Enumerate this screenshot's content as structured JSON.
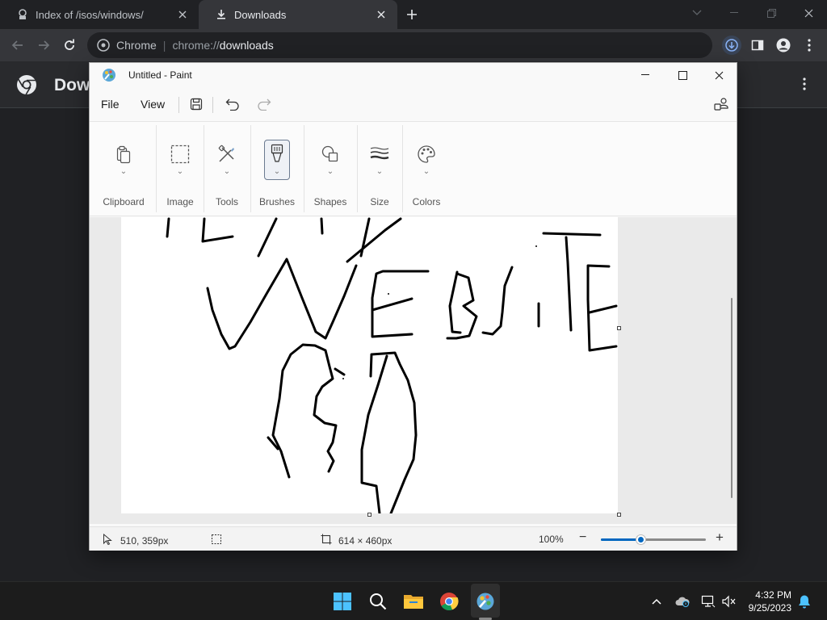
{
  "chrome": {
    "tabs": [
      {
        "label": "Index of /isos/windows/",
        "active": false
      },
      {
        "label": "Downloads",
        "active": true
      }
    ],
    "omnibox": {
      "chip": "Chrome",
      "scheme": "chrome://",
      "host": "downloads"
    },
    "page": {
      "title": "Downloads"
    }
  },
  "paint": {
    "window_title": "Untitled - Paint",
    "menu": {
      "file": "File",
      "view": "View"
    },
    "ribbon": [
      {
        "label": "Clipboard",
        "icon": "clipboard-icon"
      },
      {
        "label": "Image",
        "icon": "selection-icon"
      },
      {
        "label": "Tools",
        "icon": "tools-icon"
      },
      {
        "label": "Brushes",
        "icon": "brush-icon"
      },
      {
        "label": "Shapes",
        "icon": "shapes-icon"
      },
      {
        "label": "Size",
        "icon": "size-icon"
      },
      {
        "label": "Colors",
        "icon": "palette-icon"
      }
    ],
    "status": {
      "cursor_pos": "510, 359px",
      "canvas_size": "614 × 460px",
      "zoom": "100%",
      "zoom_fraction": 0.37
    },
    "canvas_text_hint": "WEBSITE"
  },
  "taskbar": {
    "apps": [
      "start-icon",
      "search-icon",
      "file-explorer-icon",
      "chrome-icon",
      "paint-icon"
    ],
    "time": "4:32 PM",
    "date": "9/25/2023"
  },
  "colors": {
    "chrome_bg": "#202124",
    "accent": "#0067c0",
    "ink": "#000000"
  }
}
